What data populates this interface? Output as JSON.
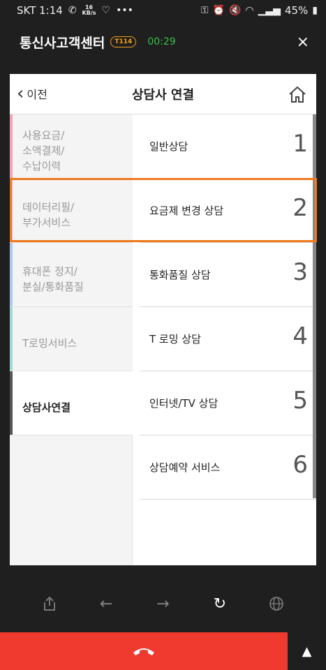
{
  "status": {
    "carrier_time": "SKT 1:14",
    "net_speed_value": "16",
    "net_speed_unit": "KB/s",
    "battery": "45%"
  },
  "header": {
    "title": "통신사고객센터",
    "badge": "T114",
    "timer": "00:29",
    "close_icon": "×"
  },
  "card": {
    "back_label": "이전",
    "title": "상담사 연결"
  },
  "categories": [
    {
      "label": "사용요금/\n소액결제/\n수납이력",
      "color": "#f3a4b5"
    },
    {
      "label": "데이터리필/\n부가서비스",
      "color": "#f1b8c6"
    },
    {
      "label": "휴대폰 정지/\n분실/통화품질",
      "color": "#a9c8ea"
    },
    {
      "label": "T로밍서비스",
      "color": "#9ed8d2"
    },
    {
      "label": "상담사연결",
      "color": "#555555"
    }
  ],
  "options": [
    {
      "label": "일반상담",
      "num": "1"
    },
    {
      "label": "요금제 변경 상담",
      "num": "2"
    },
    {
      "label": "통화품질 상담",
      "num": "3"
    },
    {
      "label": "T 로밍 상담",
      "num": "4"
    },
    {
      "label": "인터넷/TV 상담",
      "num": "5"
    },
    {
      "label": "상담예약 서비스",
      "num": "6"
    }
  ],
  "nav_icons": [
    "share-icon",
    "back-arrow-icon",
    "forward-arrow-icon",
    "refresh-icon",
    "globe-icon"
  ],
  "accent": "#f0791d"
}
